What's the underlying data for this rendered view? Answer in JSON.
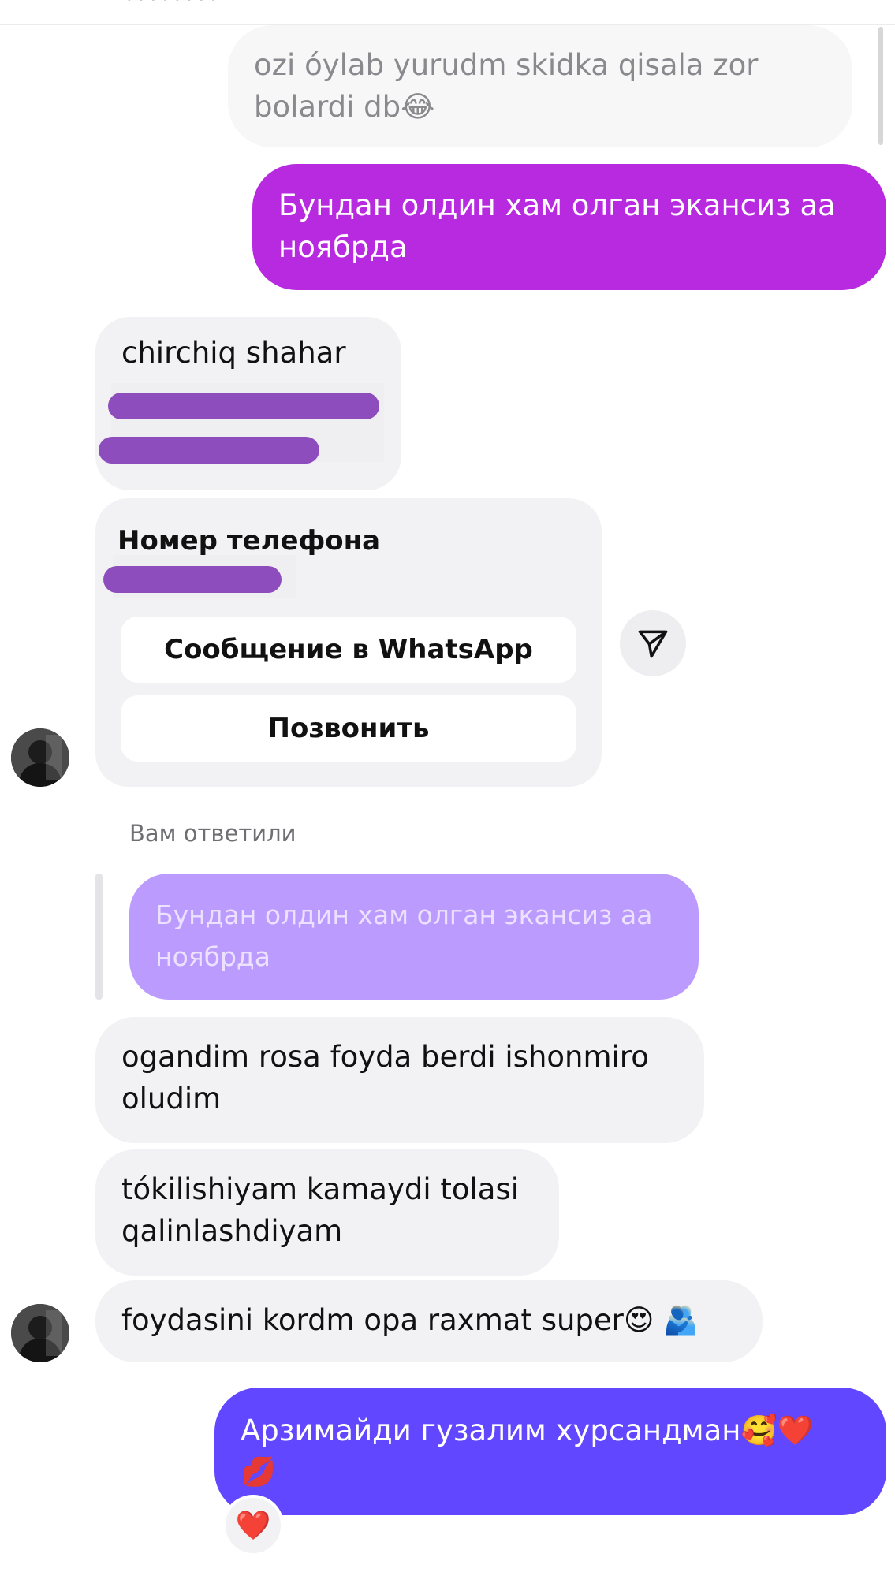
{
  "header": {
    "fragment": "· · ·  ·  ·  ·  ·  ·"
  },
  "messages": {
    "m1": "ozi óylab yurudm skidka qisala zor bolardi db😂",
    "m2": "Бундан олдин хам олган экансиз аа нoябрда",
    "m3_text": "chirchiq shahar",
    "m7": "ogandim rosa foyda berdi ishonmiro oludim",
    "m8": "tókilishiyam kamaydi tolasi qalinlashdiyam",
    "m9": "foydasini kordm opa raxmat super😍",
    "m9_emoji2": "🫂",
    "m10": "Арзимайди гузалим хурсандман🥰❤️",
    "m10_line2": "💋"
  },
  "contact": {
    "title": "Номер телефона",
    "whatsapp_label": "Сообщение в WhatsApp",
    "call_label": "Позвонить"
  },
  "reply": {
    "label": "Вам ответили",
    "quote": "Бундан олдин хам олган экансиз аа нoябрда"
  },
  "reaction": {
    "emoji": "❤️"
  },
  "icons": {
    "share": "paper-plane-icon",
    "avatar": "user-avatar"
  },
  "colors": {
    "outgoing_magenta": "#b82ae0",
    "outgoing_indigo": "#6147ff",
    "incoming": "#f2f2f4",
    "reply_quote": "#bc9bff"
  }
}
